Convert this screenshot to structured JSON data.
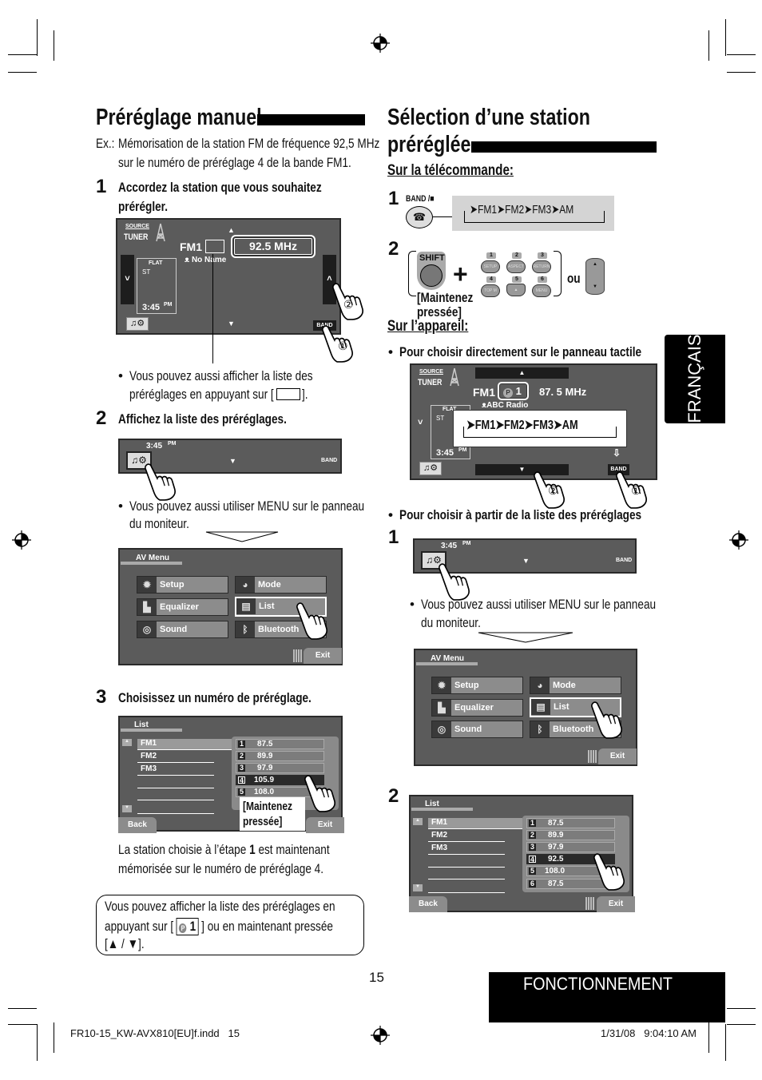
{
  "left": {
    "title": "Préréglage manuel",
    "example_label": "Ex.:",
    "example_lines": [
      "Mémorisation de la station FM de fréquence 92,5 MHz",
      "sur le numéro de préréglage 4 de la bande FM1."
    ],
    "step1": {
      "num": "1",
      "lines": [
        "Accordez la station que vous souhaitez",
        "prérégler."
      ]
    },
    "tuner_screen": {
      "source": "SOURCE",
      "tuner": "TUNER",
      "band": "FM1",
      "frequency": "92.5  MHz",
      "station_name": "No Name",
      "eq": "FLAT",
      "stereo": "ST",
      "time": "3:45",
      "ampm": "PM",
      "band_button": "BAND",
      "callout_1": "①",
      "callout_2": "②"
    },
    "bullet1": {
      "lines": [
        "Vous pouvez aussi afficher la liste des",
        "préréglages en appuyant sur [",
        "]."
      ]
    },
    "step2": {
      "num": "2",
      "text": "Affichez la liste des préréglages."
    },
    "mini_bar": {
      "time": "3:45",
      "ampm": "PM",
      "band_button": "BAND"
    },
    "bullet2": {
      "lines": [
        "Vous pouvez aussi utiliser MENU sur le panneau",
        "du moniteur."
      ]
    },
    "step3": {
      "num": "3",
      "text": "Choisissez un numéro de préréglage."
    },
    "list_screen": {
      "title": "List",
      "bands": [
        "FM1",
        "FM2",
        "FM3"
      ],
      "presets": [
        {
          "n": "1",
          "v": "87.5"
        },
        {
          "n": "2",
          "v": "89.9"
        },
        {
          "n": "3",
          "v": "97.9"
        },
        {
          "n": "4",
          "v": "105.9"
        },
        {
          "n": "5",
          "v": "108.0"
        }
      ],
      "selected": 4,
      "hold": [
        "[Maintenez",
        "pressée]"
      ],
      "back": "Back",
      "exit": "Exit"
    },
    "result_lines": [
      "La station choisie à l’étape",
      "1",
      "est maintenant",
      "mémorisée sur le numéro de préréglage 4."
    ],
    "note_box": {
      "lines": [
        "Vous pouvez afficher la liste des préréglages en",
        "appuyant sur [",
        "] ou en maintenant pressée",
        "[▲ / ▼]."
      ],
      "p_icon": "P",
      "p_num": "1"
    }
  },
  "av_menu": {
    "title": "AV Menu",
    "items": [
      "Setup",
      "Mode",
      "Equalizer",
      "List",
      "Sound",
      "Bluetooth"
    ],
    "selected": "List",
    "exit": "Exit"
  },
  "right": {
    "title_lines": [
      "Sélection d’une station",
      "préréglée"
    ],
    "remote_heading": "Sur la télécommande:",
    "step1": {
      "num": "1",
      "button": "BAND /■",
      "cycle": [
        "FM1",
        "FM2",
        "FM3",
        "AM"
      ]
    },
    "step2": {
      "num": "2",
      "shift": "SHIFT",
      "hold": [
        "[Maintenez",
        "pressée]"
      ],
      "keys": [
        {
          "n": "1",
          "l": "SETUP"
        },
        {
          "n": "2",
          "l": "ASPECT"
        },
        {
          "n": "3",
          "l": "RETURN"
        },
        {
          "n": "4",
          "l": "TOP M"
        },
        {
          "n": "5",
          "l": "▲"
        },
        {
          "n": "6",
          "l": "MENU"
        }
      ],
      "or": "ou"
    },
    "unit_heading": "Sur l’appareil:",
    "bullet_touch": "Pour choisir directement sur le panneau tactile",
    "tuner_screen": {
      "source": "SOURCE",
      "tuner": "TUNER",
      "band": "FM1",
      "preset_icon": "P",
      "preset": "1",
      "frequency": "87. 5  MHz",
      "station_name": "ABC Radio",
      "eq": "FLAT",
      "stereo": "ST",
      "time": "3:45",
      "ampm": "PM",
      "band_button": "BAND",
      "cycle": [
        "FM1",
        "FM2",
        "FM3",
        "AM"
      ],
      "callout_1": "①",
      "callout_2": "②"
    },
    "bullet_list": "Pour choisir à partir de la liste des préréglages",
    "list_step1": {
      "num": "1",
      "time": "3:45",
      "ampm": "PM",
      "band_button": "BAND"
    },
    "bullet_menu": {
      "lines": [
        "Vous pouvez aussi utiliser MENU sur le panneau",
        "du moniteur."
      ]
    },
    "list_step2": {
      "num": "2"
    },
    "list_screen": {
      "title": "List",
      "bands": [
        "FM1",
        "FM2",
        "FM3"
      ],
      "presets": [
        {
          "n": "1",
          "v": "87.5"
        },
        {
          "n": "2",
          "v": "89.9"
        },
        {
          "n": "3",
          "v": "97.9"
        },
        {
          "n": "4",
          "v": "92.5"
        },
        {
          "n": "5",
          "v": "108.0"
        },
        {
          "n": "6",
          "v": "87.5"
        }
      ],
      "selected": 4,
      "back": "Back",
      "exit": "Exit"
    }
  },
  "side_tab": "FRANÇAIS",
  "page_number": "15",
  "section_label": "FONCTIONNEMENT",
  "footer": {
    "file": "FR10-15_KW-AVX810[EU]f.indd   15",
    "date": "1/31/08   9:04:10 AM"
  }
}
